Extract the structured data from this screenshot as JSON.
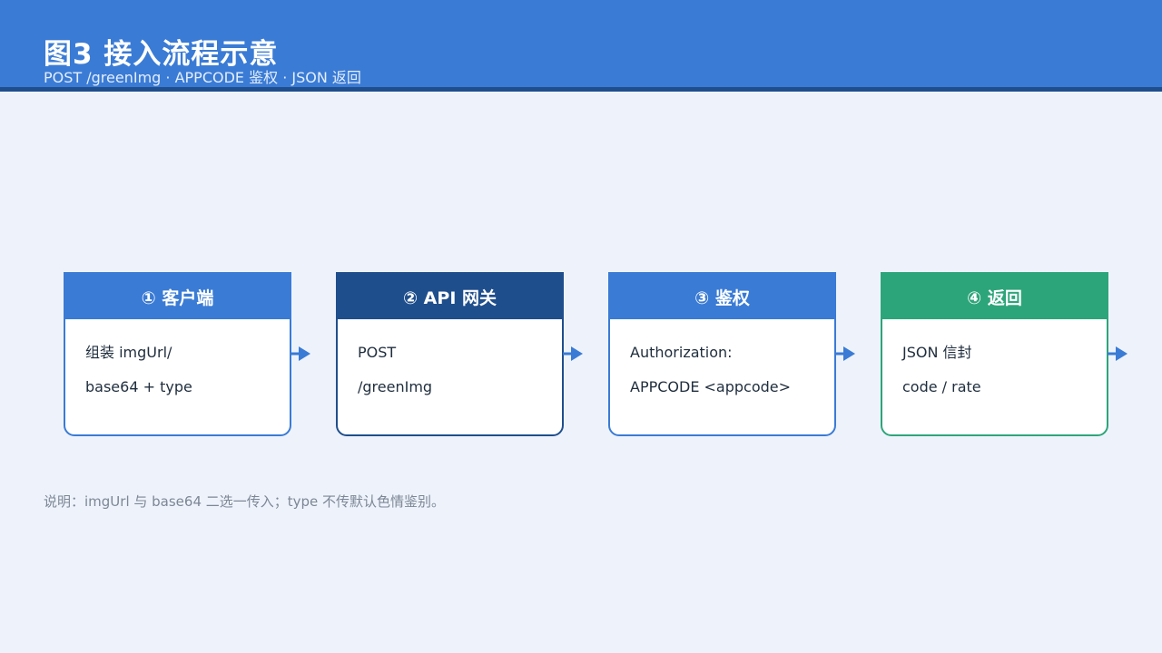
{
  "header": {
    "title": "图3  接入流程示意",
    "subtitle": "POST /greenImg · APPCODE 鉴权 · JSON 返回"
  },
  "colors": {
    "header_bg": "#3a7bd5",
    "header_rule": "#1f4e8c",
    "page_bg": "#eef3fb",
    "blue": "#3a7bd5",
    "dark_blue": "#1f4e8c",
    "green": "#2da57a"
  },
  "steps": [
    {
      "title": "① 客户端",
      "lines": [
        "组装 imgUrl/",
        "base64 + type"
      ],
      "color": "#3a7bd5"
    },
    {
      "title": "② API 网关",
      "lines": [
        "POST",
        "/greenImg"
      ],
      "color": "#1f4e8c"
    },
    {
      "title": "③ 鉴权",
      "lines": [
        "Authorization:",
        "APPCODE <appcode>"
      ],
      "color": "#3a7bd5"
    },
    {
      "title": "④ 返回",
      "lines": [
        "JSON 信封",
        "code / rate"
      ],
      "color": "#2da57a"
    }
  ],
  "note": "说明：imgUrl 与 base64 二选一传入；type 不传默认色情鉴别。"
}
